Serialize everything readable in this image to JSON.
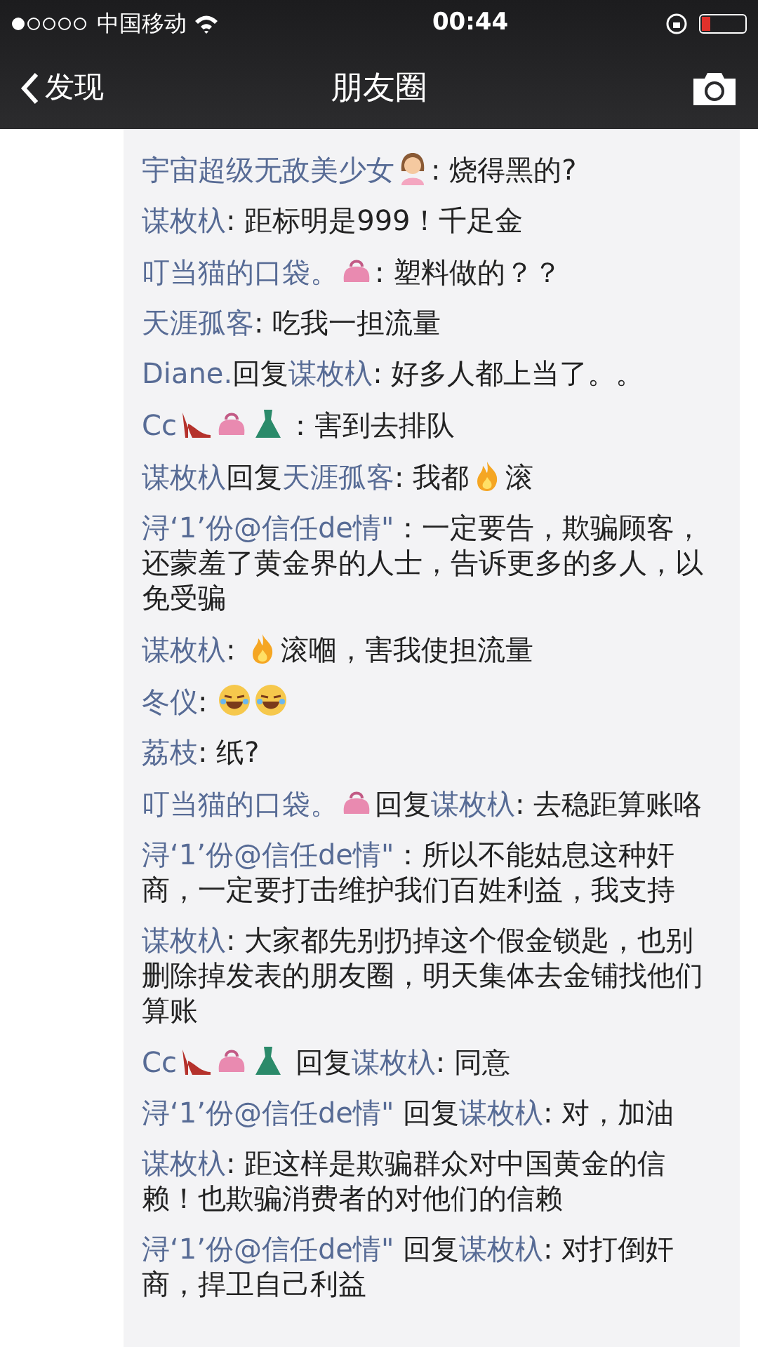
{
  "status_bar": {
    "carrier": "中国移动",
    "time": "00:44",
    "battery_low": true
  },
  "nav": {
    "back_label": "发现",
    "title": "朋友圈"
  },
  "comments": [
    {
      "parts": [
        {
          "kind": "name",
          "text": "宇宙超级无敌美少女"
        },
        {
          "kind": "woman"
        },
        {
          "kind": "text",
          "text": ": 烧得黑的?"
        }
      ]
    },
    {
      "parts": [
        {
          "kind": "name",
          "text": "谋枚杁"
        },
        {
          "kind": "text",
          "text": ": 距标明是999！千足金"
        }
      ]
    },
    {
      "parts": [
        {
          "kind": "name",
          "text": "叮当猫的口袋。"
        },
        {
          "kind": "purse"
        },
        {
          "kind": "text",
          "text": ": 塑料做的？？"
        }
      ]
    },
    {
      "parts": [
        {
          "kind": "name",
          "text": "天涯孤客"
        },
        {
          "kind": "text",
          "text": ": 吃我一担流量"
        }
      ]
    },
    {
      "parts": [
        {
          "kind": "name",
          "text": "Diane."
        },
        {
          "kind": "text",
          "text": "回复"
        },
        {
          "kind": "name",
          "text": "谋枚杁"
        },
        {
          "kind": "text",
          "text": ": 好多人都上当了。。"
        }
      ]
    },
    {
      "parts": [
        {
          "kind": "name",
          "text": "Cc"
        },
        {
          "kind": "heels"
        },
        {
          "kind": "purse"
        },
        {
          "kind": "dress"
        },
        {
          "kind": "text",
          "text": "：害到去排队"
        }
      ]
    },
    {
      "parts": [
        {
          "kind": "name",
          "text": "谋枚杁"
        },
        {
          "kind": "text",
          "text": "回复"
        },
        {
          "kind": "name",
          "text": "天涯孤客"
        },
        {
          "kind": "text",
          "text": ": 我都"
        },
        {
          "kind": "fire"
        },
        {
          "kind": "text",
          "text": "滚"
        }
      ]
    },
    {
      "parts": [
        {
          "kind": "name",
          "text": "浔‘1’份@信任de情\""
        },
        {
          "kind": "text",
          "text": "：一定要告，欺骗顾客，还蒙羞了黄金界的人士，告诉更多的多人，以免受骗"
        }
      ]
    },
    {
      "parts": [
        {
          "kind": "name",
          "text": "谋枚杁"
        },
        {
          "kind": "text",
          "text": ": "
        },
        {
          "kind": "fire"
        },
        {
          "kind": "text",
          "text": "滚嗰，害我使担流量"
        }
      ]
    },
    {
      "parts": [
        {
          "kind": "name",
          "text": "冬仪"
        },
        {
          "kind": "text",
          "text": ": "
        },
        {
          "kind": "laugh"
        },
        {
          "kind": "laugh"
        }
      ]
    },
    {
      "parts": [
        {
          "kind": "name",
          "text": "荔枝"
        },
        {
          "kind": "text",
          "text": ": 纸?"
        }
      ]
    },
    {
      "parts": [
        {
          "kind": "name",
          "text": "叮当猫的口袋。"
        },
        {
          "kind": "purse"
        },
        {
          "kind": "text",
          "text": "回复"
        },
        {
          "kind": "name",
          "text": "谋枚杁"
        },
        {
          "kind": "text",
          "text": ": 去稳距算账咯"
        }
      ]
    },
    {
      "parts": [
        {
          "kind": "name",
          "text": "浔‘1’份@信任de情\""
        },
        {
          "kind": "text",
          "text": "：所以不能姑息这种奸商，一定要打击维护我们百姓利益，我支持"
        }
      ]
    },
    {
      "parts": [
        {
          "kind": "name",
          "text": "谋枚杁"
        },
        {
          "kind": "text",
          "text": ": 大家都先别扔掉这个假金锁匙，也别删除掉发表的朋友圈，明天集体去金铺找他们算账"
        }
      ]
    },
    {
      "parts": [
        {
          "kind": "name",
          "text": "Cc"
        },
        {
          "kind": "heels"
        },
        {
          "kind": "purse"
        },
        {
          "kind": "dress"
        },
        {
          "kind": "text",
          "text": " 回复"
        },
        {
          "kind": "name",
          "text": "谋枚杁"
        },
        {
          "kind": "text",
          "text": ": 同意"
        }
      ]
    },
    {
      "parts": [
        {
          "kind": "name",
          "text": "浔‘1’份@信任de情\""
        },
        {
          "kind": "text",
          "text": " 回复"
        },
        {
          "kind": "name",
          "text": "谋枚杁"
        },
        {
          "kind": "text",
          "text": ": 对，加油"
        }
      ]
    },
    {
      "parts": [
        {
          "kind": "name",
          "text": "谋枚杁"
        },
        {
          "kind": "text",
          "text": ": 距这样是欺骗群众对中国黄金的信赖！也欺骗消费者的对他们的信赖"
        }
      ]
    },
    {
      "parts": [
        {
          "kind": "name",
          "text": "浔‘1’份@信任de情\""
        },
        {
          "kind": "text",
          "text": " 回复"
        },
        {
          "kind": "name",
          "text": "谋枚杁"
        },
        {
          "kind": "text",
          "text": ": 对打倒奸商，捍卫自己利益"
        }
      ]
    }
  ]
}
